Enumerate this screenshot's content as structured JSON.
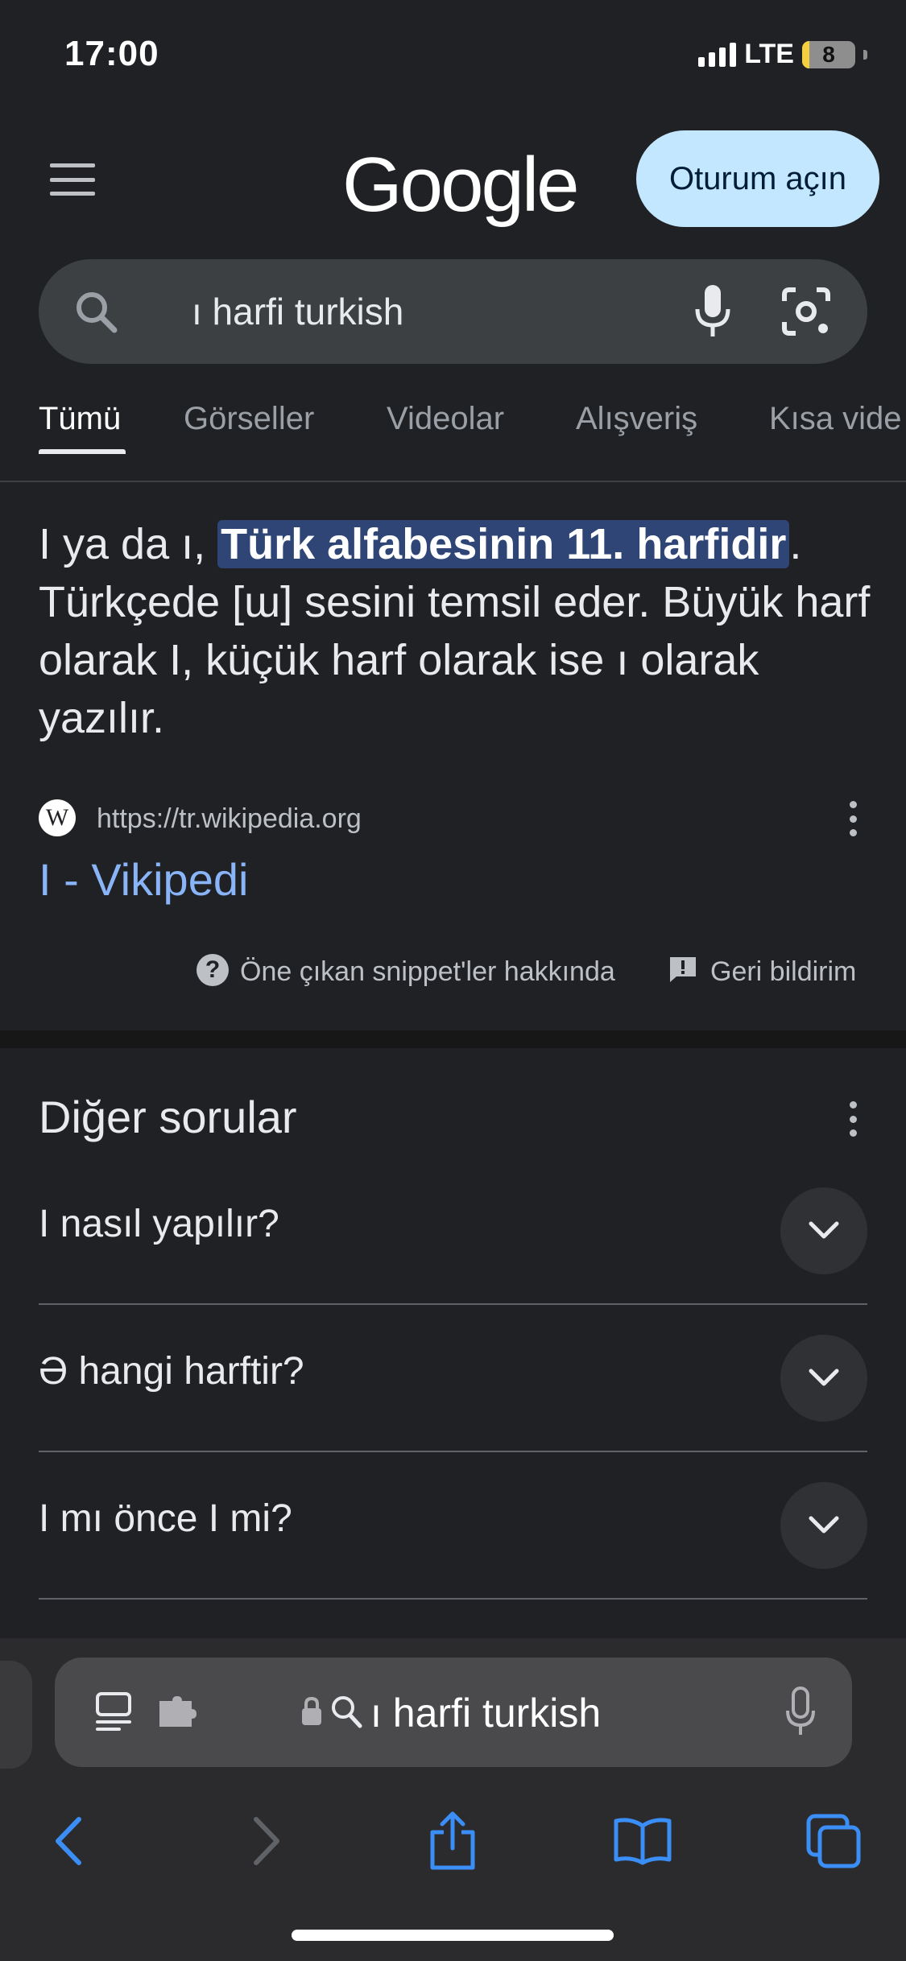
{
  "status_bar": {
    "time": "17:00",
    "network": "LTE",
    "battery_level": "8"
  },
  "header": {
    "logo": "Google",
    "signin_label": "Oturum açın",
    "menu_icon": "hamburger-icon"
  },
  "search": {
    "query": "ı harfi turkish",
    "icons": [
      "search-icon",
      "mic-icon",
      "lens-icon"
    ]
  },
  "tabs": [
    {
      "label": "Tümü",
      "active": true
    },
    {
      "label": "Görseller",
      "active": false
    },
    {
      "label": "Videolar",
      "active": false
    },
    {
      "label": "Alışveriş",
      "active": false
    },
    {
      "label": "Kısa vide",
      "active": false
    }
  ],
  "snippet": {
    "text_before": "I ya da ı, ",
    "highlight": "Türk alfabesinin 11. harfidir",
    "text_after": ". Türkçede [ɯ] sesini temsil eder. Büyük harf olarak I, küçük harf olarak ise ı olarak yazılır.",
    "source_url": "https://tr.wikipedia.org",
    "source_icon_letter": "W",
    "result_title": "I - Vikipedi",
    "about_label": "Öne çıkan snippet'ler hakkında",
    "feedback_label": "Geri bildirim"
  },
  "people_also_ask": {
    "title": "Diğer sorular",
    "questions": [
      "I nasıl yapılır?",
      "Ə hangi harftir?",
      "I mı önce I mi?"
    ]
  },
  "safari": {
    "address_text": "ı harfi turkish",
    "toolbar_icons": [
      "back-icon",
      "forward-icon",
      "share-icon",
      "bookmarks-icon",
      "tabs-icon"
    ]
  },
  "colors": {
    "background": "#202124",
    "signin_bg": "#c2e7ff",
    "link": "#8ab4f8",
    "highlight_bg": "#2e4576",
    "safari_blue": "#3a8ef6"
  }
}
